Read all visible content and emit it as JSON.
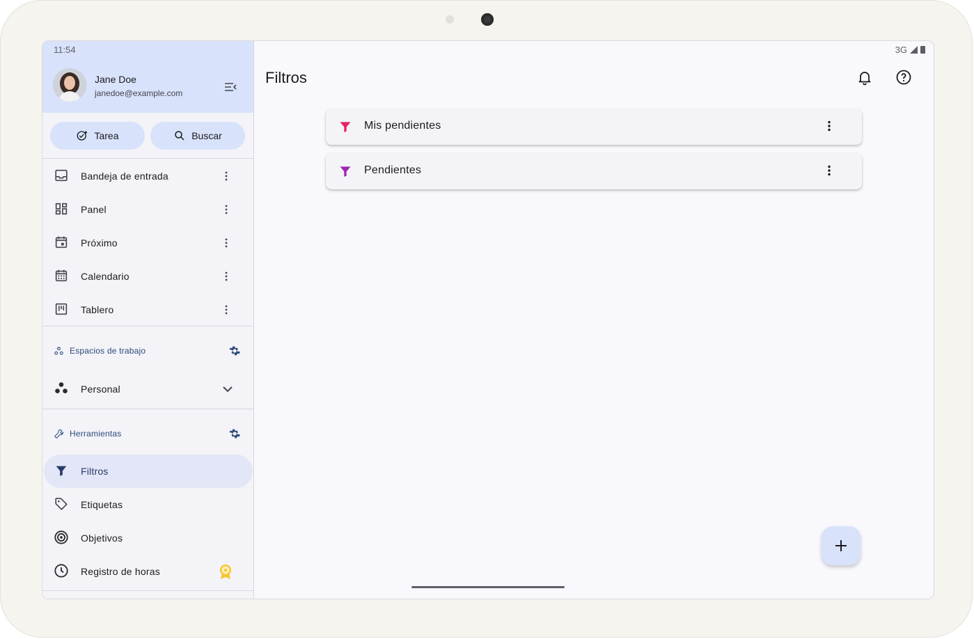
{
  "status": {
    "time": "11:54",
    "network": "3G"
  },
  "profile": {
    "name": "Jane Doe",
    "email": "janedoe@example.com"
  },
  "actions": {
    "task_label": "Tarea",
    "search_label": "Buscar"
  },
  "nav": [
    {
      "label": "Bandeja de entrada",
      "icon": "inbox-icon"
    },
    {
      "label": "Panel",
      "icon": "dashboard-icon"
    },
    {
      "label": "Próximo",
      "icon": "calendar-event-icon"
    },
    {
      "label": "Calendario",
      "icon": "calendar-month-icon"
    },
    {
      "label": "Tablero",
      "icon": "board-icon"
    }
  ],
  "workspaces": {
    "header": "Espacios de trabajo",
    "items": [
      {
        "label": "Personal"
      }
    ]
  },
  "tools": {
    "header": "Herramientas",
    "items": [
      {
        "label": "Filtros",
        "icon": "filter-icon",
        "active": true
      },
      {
        "label": "Etiquetas",
        "icon": "tag-icon"
      },
      {
        "label": "Objetivos",
        "icon": "target-icon"
      },
      {
        "label": "Registro de horas",
        "icon": "clock-icon",
        "badge": "premium-badge-icon"
      }
    ]
  },
  "main": {
    "title": "Filtros",
    "filters": [
      {
        "label": "Mis pendientes",
        "color": "#e91e63"
      },
      {
        "label": "Pendientes",
        "color": "#9c27b0"
      }
    ]
  },
  "colors": {
    "accent": "#d8e2fb",
    "sidebar_bg": "#f3f3f8",
    "active_item": "#e2e6f6"
  }
}
